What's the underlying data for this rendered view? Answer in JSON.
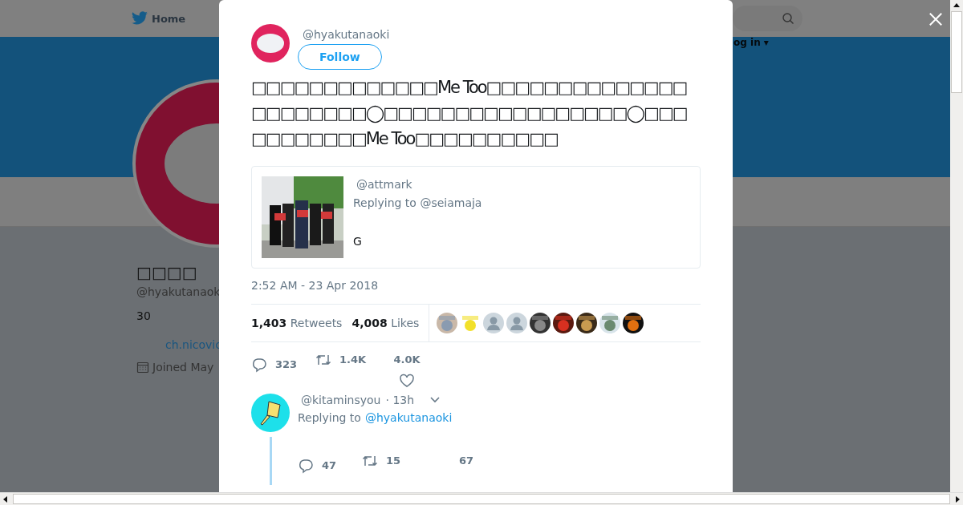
{
  "background_page": {
    "nav": {
      "home": "Home",
      "login": "og in ▾"
    },
    "profile": {
      "name": "□□□□",
      "handle": "@hyakutanaok",
      "bio": "30",
      "link": "ch.nicovic",
      "joined": "Joined May"
    }
  },
  "tweet": {
    "handle": "@hyakutanaoki",
    "follow_button": "Follow",
    "text": "□□□□□□□□□□□□□Me Too□□□□□□□□□□□□□□□□□□□□□□◯□□□□□□□□□□□□□□□□□◯□□□□□□□□□□□Me Too□□□□□□□□□□",
    "quoted": {
      "handle": "@attmark",
      "replying": "Replying to @seiamaja",
      "text": "G"
    },
    "timestamp": "2:52 AM - 23 Apr 2018",
    "stats": {
      "retweets": "1,403",
      "retweets_label": "Retweets",
      "likes": "4,008",
      "likes_label": "Likes"
    },
    "liker_avatars": [
      {
        "kind": "picture"
      },
      {
        "kind": "picture"
      },
      {
        "kind": "default"
      },
      {
        "kind": "default"
      },
      {
        "kind": "picture"
      },
      {
        "kind": "picture"
      },
      {
        "kind": "picture"
      },
      {
        "kind": "picture"
      },
      {
        "kind": "picture"
      }
    ],
    "actions": [
      {
        "kind": "reply",
        "count": "323"
      },
      {
        "kind": "retweet",
        "count": "1.4K"
      },
      {
        "kind": "like",
        "count": "4.0K"
      }
    ]
  },
  "replies": [
    {
      "handle": "@kitaminsyou",
      "time": "· 13h",
      "replying_label": "Replying to",
      "replying_to": "@hyakutanaoki",
      "actions": [
        {
          "kind": "reply",
          "count": "47"
        },
        {
          "kind": "retweet",
          "count": "15"
        },
        {
          "kind": "like",
          "count": "67"
        }
      ]
    }
  ]
}
